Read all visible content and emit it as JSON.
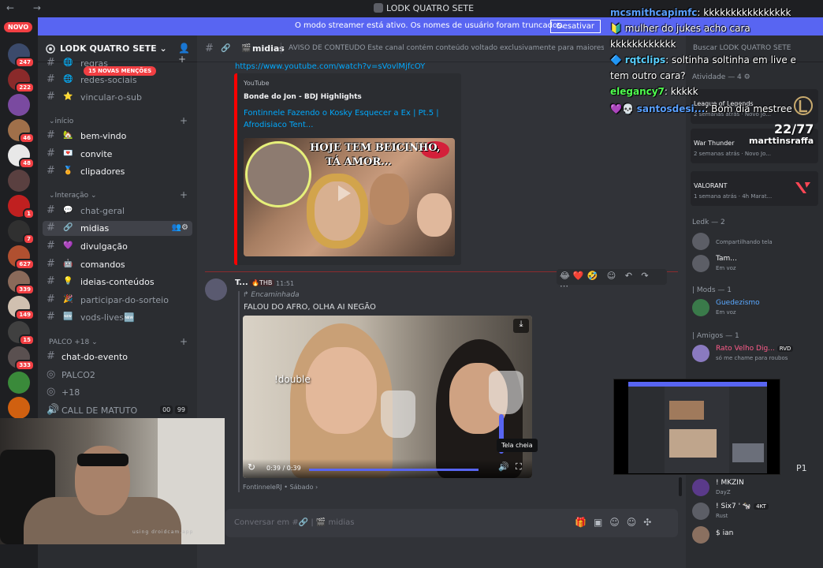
{
  "window": {
    "title": "LODK QUATRO SETE",
    "nav": "← →"
  },
  "banner": {
    "message": "O modo streamer está ativo. Os nomes de usuário foram truncados.",
    "button": "Desativar"
  },
  "rail": {
    "novo": "NOVO",
    "servers": [
      {
        "badge": "247",
        "color": "#3b4a6b"
      },
      {
        "badge": "222",
        "color": "#8a2a2a"
      },
      {
        "badge": "",
        "color": "#7a4aa0"
      },
      {
        "badge": "46",
        "color": "#a0704a"
      },
      {
        "badge": "48",
        "color": "#e8e8e8"
      },
      {
        "badge": "",
        "color": "#5a4040"
      },
      {
        "badge": "1",
        "color": "#c02020"
      },
      {
        "badge": "7",
        "color": "#303030"
      },
      {
        "badge": "627",
        "color": "#b05030"
      },
      {
        "badge": "339",
        "color": "#8a6a5a"
      },
      {
        "badge": "149",
        "color": "#d0c0b0"
      },
      {
        "badge": "15",
        "color": "#404040"
      },
      {
        "badge": "333",
        "color": "#5a5050"
      },
      {
        "badge": "",
        "color": "#3a8a3a"
      },
      {
        "badge": "",
        "color": "#d06010"
      }
    ]
  },
  "sidebar": {
    "guild_name": "LODK QUATRO SETE",
    "new_mentions": "15 NOVAS MENÇÕES",
    "categories": {
      "inicio": "início",
      "interacao": "Interação",
      "palco": "PALCO +18"
    },
    "channels": [
      {
        "emoji": "🌐",
        "label": "regras"
      },
      {
        "emoji": "🌐",
        "label": "redes-sociais"
      },
      {
        "emoji": "⭐",
        "label": "vincular-o-sub"
      },
      {
        "emoji": "🏡",
        "label": "bem-vindo"
      },
      {
        "emoji": "💌",
        "label": "convite"
      },
      {
        "emoji": "🏅",
        "label": "clipadores"
      },
      {
        "emoji": "💬",
        "label": "chat-geral"
      },
      {
        "emoji": "🎬",
        "label": "midias"
      },
      {
        "emoji": "💜",
        "label": "divulgação"
      },
      {
        "emoji": "🤖",
        "label": "comandos"
      },
      {
        "emoji": "💡",
        "label": "ideias-conteúdos"
      },
      {
        "emoji": "🎉",
        "label": "participar-do-sorteio"
      },
      {
        "emoji": "🆕",
        "label": "vods-lives🆕"
      },
      {
        "emoji": "",
        "label": "chat-do-evento"
      },
      {
        "emoji": "",
        "label": "PALCO2"
      },
      {
        "emoji": "",
        "label": "+18"
      },
      {
        "emoji": "",
        "label": "CALL DE MATUTO",
        "count_a": "00",
        "count_b": "99"
      }
    ]
  },
  "webcam": {
    "watermark": "using droidcam.app"
  },
  "main": {
    "channel_name": "midias",
    "topic": "AVISO DE CONTEÚDO Este canal contém conteúdo voltado exclusivamente para maiores de 18 a...",
    "link": "https://www.youtube.com/watch?v=sVovlMjfcOY",
    "embed": {
      "provider": "YouTube",
      "author": "Bonde do Jon - BDJ Highlights",
      "title": "Fontinnele Fazendo o Kosky Esquecer a Ex | Pt.5 | Afrodisiaco Tent...",
      "thumb_caption_1": "HOJE TEM BEICINHO,",
      "thumb_caption_2": "TÁ AMOR..."
    },
    "reactions": "😂❤️🤣 ☺ ↶ ↷ ⋯",
    "message": {
      "author": "T...",
      "tag": "🔥THB",
      "time": "11:51",
      "forwarded": "↱ Encaminhada",
      "text": "FALOU DO AFRO, OLHA AI NEGÃO",
      "video_overlay": "!double",
      "video_time": "0:39 / 0:39",
      "tooltip": "Tela cheia",
      "source": "FontinneleRJ • Sábado ›"
    },
    "composer_placeholder": "Conversar em #🔗 | 🎬 midias"
  },
  "members": {
    "search_placeholder": "Buscar LODK QUATRO SETE",
    "activity_header": "Atividade — 4",
    "activities": [
      {
        "name": "League of Legends",
        "sub": "2 semanas atrás · Novo Jo..."
      },
      {
        "name": "War Thunder",
        "sub": "2 semanas atrás · Novo Jo..."
      },
      {
        "name": "VALORANT",
        "sub": "1 semana atrás · 4h Marat..."
      }
    ],
    "ledk_header": "Ledk — 2",
    "ledk": [
      {
        "name": "",
        "status": "Compartilhando tela"
      },
      {
        "name": "Tam...",
        "status": "Em voz"
      }
    ],
    "mods_header": "| Mods — 1",
    "mods": [
      {
        "name": "Guedezismo",
        "status": "Em voz"
      }
    ],
    "amigos_header": "| Amigos — 1",
    "amigos": [
      {
        "name": "Rato Velho Dig...",
        "tag": "RVD",
        "status": "só me chame para roubos"
      }
    ],
    "others": [
      {
        "name": "! MKZIN",
        "status": "DayZ"
      },
      {
        "name": "! Six7 ' 🐄",
        "tag": "4KT",
        "status": "Rust"
      },
      {
        "name": "$ ian",
        "status": ""
      }
    ],
    "p1_tag": "P1"
  },
  "chat_overlay": [
    {
      "user": "mcsmithcapimfc",
      "color": "#5aa0ff",
      "text": "kkkkkkkkkkkkkkkk"
    },
    {
      "user": "",
      "color": "#ffffff",
      "text": "mulher do jukes acho cara"
    },
    {
      "user": "",
      "color": "#ffffff",
      "text": "kkkkkkkkkkkk"
    },
    {
      "user": "rqtclips",
      "color": "#5ad0ff",
      "text": "soltinha soltinha em live e"
    },
    {
      "user": "",
      "color": "#ffffff",
      "text": "tem outro cara?"
    },
    {
      "user": "elegancy7",
      "color": "#50ff50",
      "text": "kkkkk"
    },
    {
      "user": "santosdesi...",
      "color": "#5aa0ff",
      "text": "Bom dia mestree"
    }
  ],
  "counter": {
    "value": "22/77",
    "name": "marttinsraffa"
  }
}
